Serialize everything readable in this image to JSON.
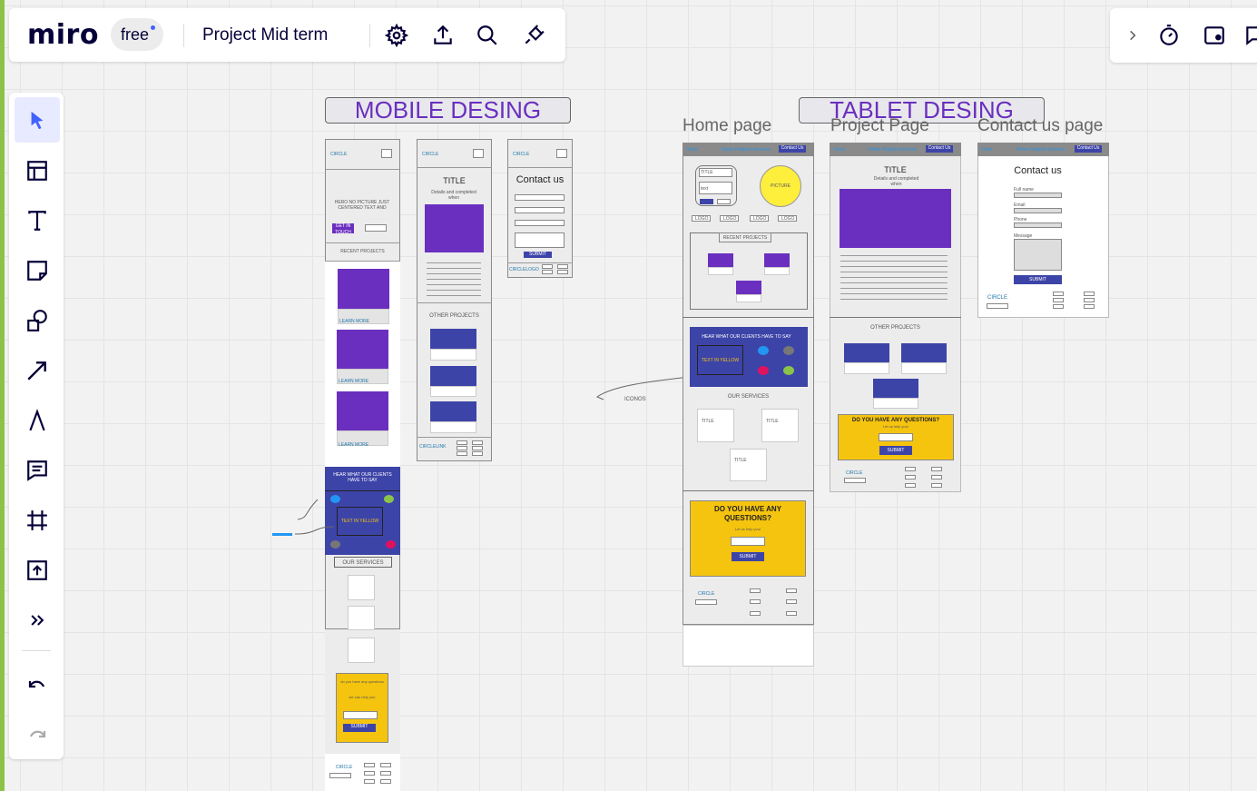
{
  "app": {
    "logo": "miro",
    "plan": "free",
    "board_title": "Project Mid term"
  },
  "colors": {
    "accent": "#4262ff",
    "purple": "#6a2fbf",
    "blue": "#3d44a8",
    "yellow": "#f5c40f"
  },
  "toolbar_icons": [
    "select-icon",
    "templates-icon",
    "text-icon",
    "sticky-note-icon",
    "shapes-icon",
    "arrow-icon",
    "pen-icon",
    "comment-icon",
    "frame-icon",
    "upload-icon",
    "more-tools-icon",
    "undo-icon",
    "redo-icon"
  ],
  "sections": {
    "mobile_title": "MOBILE DESING",
    "tablet_title": "TABLET DESING"
  },
  "page_labels": {
    "home": "Home page",
    "project": "Project Page",
    "contact": "Contact us page"
  },
  "mobile": {
    "logo": "CIRCLE",
    "hero": "HERO NO PICTURE JUST CENTERED TEXT AND",
    "hero_btn": "GET IN TOUCH",
    "hero_btn2": "check it out",
    "recent": "RECENT PROJECTS",
    "learn": "LEARN MORE",
    "clients": "HEAR WHAT OUR CLIENTS HAVE TO SAY",
    "text_yellow": "TEXT IN YELLOW",
    "services": "OUR SERVICES",
    "question": "do you have any questions",
    "help": "we can help you",
    "submit": "SUBMIT",
    "footer_logo": "CIRCLE",
    "project_title": "TITLE",
    "project_sub": "Details and completed when",
    "other_projects": "OTHER PROJECTS",
    "circle_link": "CIRCLELINK",
    "contact_title": "Contact us",
    "circle_logo": "CIRCLELOGO"
  },
  "tablet": {
    "logo": "Circle",
    "nav_links": "Home Projects Services",
    "contact_btn": "Contact Us",
    "title_field": "TITLE",
    "text_field": "text",
    "picture": "PICTURE",
    "logo_tag": "LOGO",
    "recent": "RECENT PROJECTS",
    "clients": "HEAR WHAT OUR CLIENTS HAVE TO SAY",
    "text_yellow": "TEXT IN YELLOW",
    "services": "OUR SERVICES",
    "service_title": "TITLE",
    "question": "DO YOU HAVE ANY QUESTIONS?",
    "help": "Let us help you!",
    "email": "email / here",
    "submit": "SUBMIT",
    "footer_logo": "CIRCLE",
    "project_title": "TITLE",
    "project_sub": "Details and completed when",
    "other_projects": "OTHER PROJECTS",
    "contact_title": "Contact us",
    "fullname": "Full name",
    "email_label": "Email",
    "phone": "Phone",
    "message": "Message"
  },
  "annotation": {
    "icons_label": "ICONOS"
  }
}
